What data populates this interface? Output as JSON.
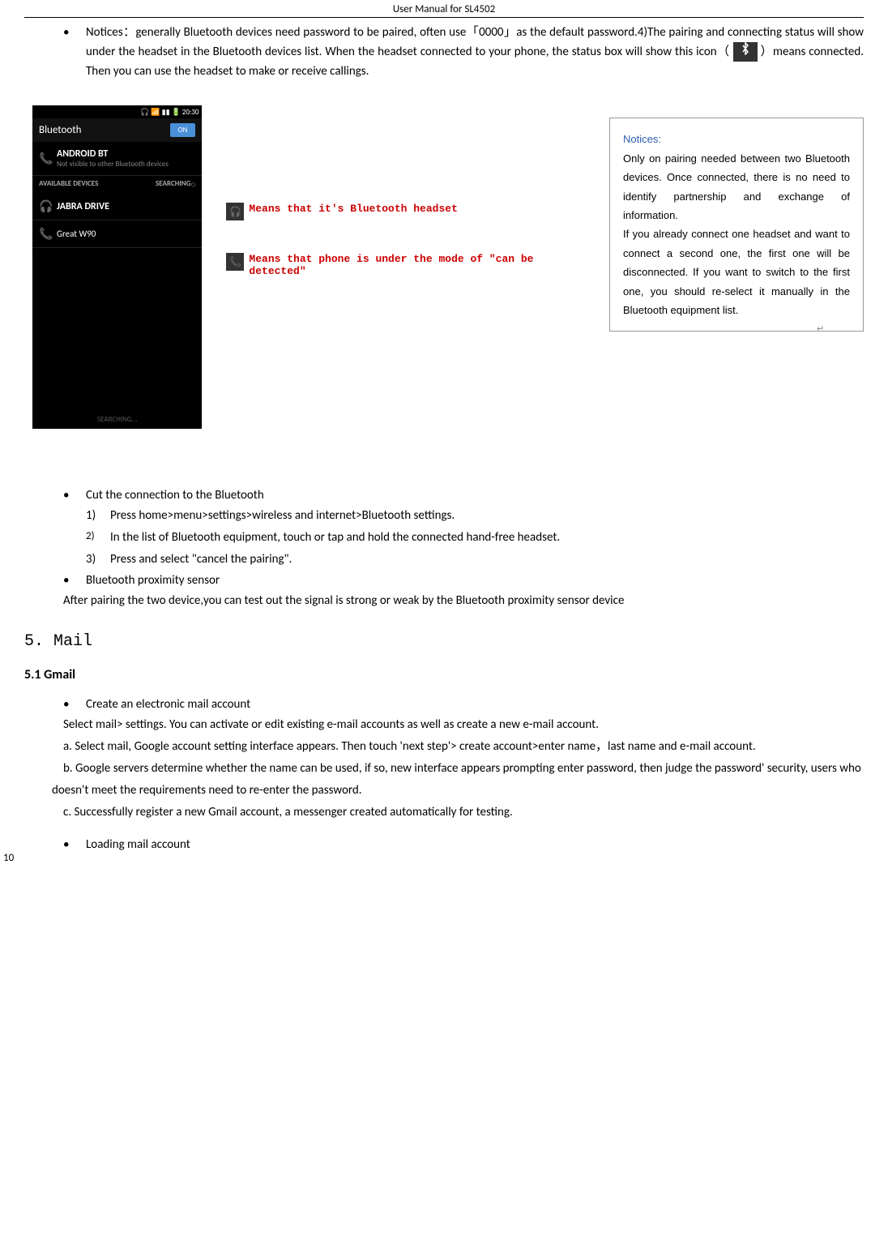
{
  "header": "User Manual for SL4502",
  "notices_para": "Notices：generally Bluetooth devices need password to be paired, often use「0000」as the default password.4)The pairing and connecting status will show under the headset in the Bluetooth devices list. When the headset connected to your phone, the status box will show this icon（",
  "notices_para_after": "）means connected. Then you can use the headset to make or receive callings.",
  "phone": {
    "time": "20:30",
    "title": "Bluetooth",
    "toggle": "ON",
    "device_name": "ANDROID BT",
    "device_sub": "Not visible to other Bluetooth devices",
    "avail_label": "AVAILABLE DEVICES",
    "searching_label": "SEARCHING",
    "dev1": "JABRA DRIVE",
    "dev2": "Great W90",
    "footer": "SEARCHING..."
  },
  "annot1": "Means that it's Bluetooth headset",
  "annot2": "Means that phone is under the mode of \"can be detected\"",
  "notices_box": {
    "title": "Notices:",
    "body": "Only on pairing needed between two Bluetooth devices. Once connected, there is no need to identify partnership and exchange of information.\nIf you already connect one headset and want to connect a second one, the first one will be disconnected. If you want to switch to the first one, you should re-select it manually in the Bluetooth equipment list."
  },
  "cut_title": "Cut the connection to the Bluetooth",
  "cut_steps": [
    "Press home>menu>settings>wireless and internet>Bluetooth settings.",
    "In the list of Bluetooth equipment, touch or tap and hold the connected hand-free headset.",
    "Press and select \"cancel the pairing\"."
  ],
  "prox_title": "Bluetooth proximity sensor",
  "prox_text": "After pairing the two device,you can test out the signal is strong or weak by the Bluetooth proximity sensor device",
  "mail_heading": "5. Mail",
  "gmail_heading": "5.1 Gmail",
  "create_title": "Create an electronic mail account",
  "create_intro": "Select mail> settings. You can activate or edit existing e-mail accounts as well as create a new e-mail account.",
  "create_a": "a.   Select mail, Google account setting interface appears. Then touch 'next step'> create account>enter name，last name and e-mail account.",
  "create_b": "b.   Google servers determine whether the name can be used, if so, new interface appears prompting enter password, then judge the password' security, users who doesn't meet the requirements need to re-enter the password.",
  "create_c": "c.   Successfully register a new Gmail account, a messenger created automatically for testing.",
  "loading_title": "Loading mail account",
  "page_number": "10"
}
